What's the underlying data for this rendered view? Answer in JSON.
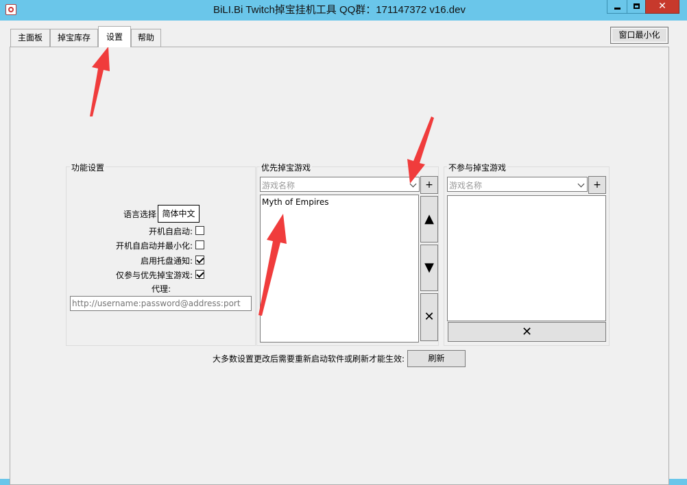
{
  "window": {
    "title": "BiLI.Bi Twitch掉宝挂机工具 QQ群：171147372 v16.dev",
    "close_glyph": "✕"
  },
  "tabs": [
    {
      "label": "主面板"
    },
    {
      "label": "掉宝库存"
    },
    {
      "label": "设置"
    },
    {
      "label": "帮助"
    }
  ],
  "toolbar": {
    "minimize_label": "窗口最小化"
  },
  "settings": {
    "group_title": "功能设置",
    "language_label": "语言选择",
    "language_value": "简体中文",
    "autostart_label": "开机自启动:",
    "autostart_checked": false,
    "autostart_min_label": "开机自启动并最小化:",
    "autostart_min_checked": false,
    "tray_label": "启用托盘通知:",
    "tray_checked": true,
    "priority_only_label": "仅参与优先掉宝游戏:",
    "priority_only_checked": true,
    "proxy_label": "代理:",
    "proxy_placeholder": "http://username:password@address:port"
  },
  "priority": {
    "group_title": "优先掉宝游戏",
    "combo_placeholder": "游戏名称",
    "add_label": "+",
    "games": [
      "Myth of Empires"
    ],
    "up_label": "▲",
    "down_label": "▼",
    "remove_label": "✕"
  },
  "exclude": {
    "group_title": "不参与掉宝游戏",
    "combo_placeholder": "游戏名称",
    "add_label": "+",
    "remove_label": "✕"
  },
  "footer": {
    "note": "大多数设置更改后需要重新启动软件或刷新才能生效:",
    "refresh_label": "刷新"
  },
  "colors": {
    "titlebar": "#6ac6ea",
    "close_button": "#c7392c",
    "annotation_arrow": "#f03c3c"
  }
}
